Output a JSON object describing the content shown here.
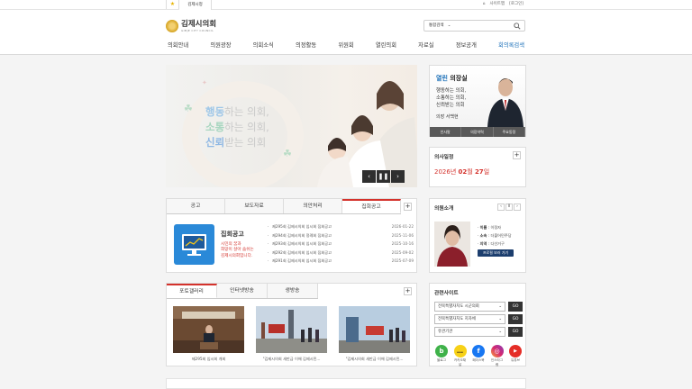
{
  "topbar": {
    "tab_label": "김제시청",
    "links": [
      "사이트맵",
      "[로그인]"
    ]
  },
  "header": {
    "logo_title": "김제시의회",
    "logo_sub": "GIMJE CITY COUNCIL",
    "search_option": "통합검색"
  },
  "nav": [
    "의회안내",
    "의원광장",
    "의회소식",
    "의정활동",
    "위원회",
    "열린의회",
    "자료실",
    "정보공개",
    "회의록검색"
  ],
  "hero": {
    "line1_em": "행동",
    "line1_rest": "하는 의회,",
    "line2_em": "소통",
    "line2_rest": "하는 의회,",
    "line3_em": "신뢰",
    "line3_rest": "받는 의회"
  },
  "speaker": {
    "title_em": "열린",
    "title_rest": " 의장실",
    "lines": [
      "행동하는 의회,",
      "소통하는 의회,",
      "신뢰받는 의회"
    ],
    "name": "의장 서백현",
    "tabs": [
      "인사말",
      "의장약력",
      "주요동정"
    ]
  },
  "schedule": {
    "title": "의사일정",
    "year": "2026년",
    "month": "02",
    "month_unit": "월",
    "day": "27",
    "day_unit": "일"
  },
  "notice": {
    "tabs": [
      "공고",
      "보도자료",
      "의안처리",
      "집회공고"
    ],
    "heading": "집회공고",
    "desc": [
      "시민의 꿈과",
      "희망이 살아 숨쉬는",
      "김제시의회입니다."
    ],
    "items": [
      {
        "title": "제295회 김제시의회 임시회 집회공고",
        "date": "2026-01-22"
      },
      {
        "title": "제294회 김제시의회 정례회 집회공고",
        "date": "2025-11-06"
      },
      {
        "title": "제293회 김제시의회 임시회 집회공고",
        "date": "2025-10-16"
      },
      {
        "title": "제292회 김제시의회 임시회 집회공고",
        "date": "2025-09-02"
      },
      {
        "title": "제291회 김제시의회 임시회 집회공고",
        "date": "2025-07-09"
      }
    ]
  },
  "gallery": {
    "tabs": [
      "포토갤러리",
      "인터넷방송",
      "생방송"
    ],
    "items": [
      {
        "caption": "제295회 임시회 개회"
      },
      {
        "caption": "\"김제시의회 새만금 이해 김제시민..."
      },
      {
        "caption": "\"김제시의회 새만금 이해 김제시민..."
      }
    ]
  },
  "councilor": {
    "title": "의원소개",
    "fields": [
      {
        "label": "이름",
        "value": "이정자"
      },
      {
        "label": "소속",
        "value": "더불어민주당"
      },
      {
        "label": "지역",
        "value": "다선거구"
      }
    ],
    "button": "프로필 보러 가기"
  },
  "related": {
    "title": "관련사이트",
    "selects": [
      "전북특별자치도 시군의회",
      "전북특별자치도 지자체",
      "유관기관"
    ],
    "go_label": "GO",
    "sns": [
      {
        "icon": "blog-icon",
        "label": "블로그",
        "color": "#3fb24a",
        "glyph": "b"
      },
      {
        "icon": "kakao-icon",
        "label": "카카오채널",
        "color": "#f7d117",
        "glyph": "…"
      },
      {
        "icon": "facebook-icon",
        "label": "페이스북",
        "color": "#1877f2",
        "glyph": "f"
      },
      {
        "icon": "instagram-icon",
        "label": "인스타그램",
        "color": "#d6296e",
        "glyph": "◎"
      },
      {
        "icon": "youtube-icon",
        "label": "유튜브",
        "color": "#e52d27",
        "glyph": "▶"
      }
    ]
  }
}
